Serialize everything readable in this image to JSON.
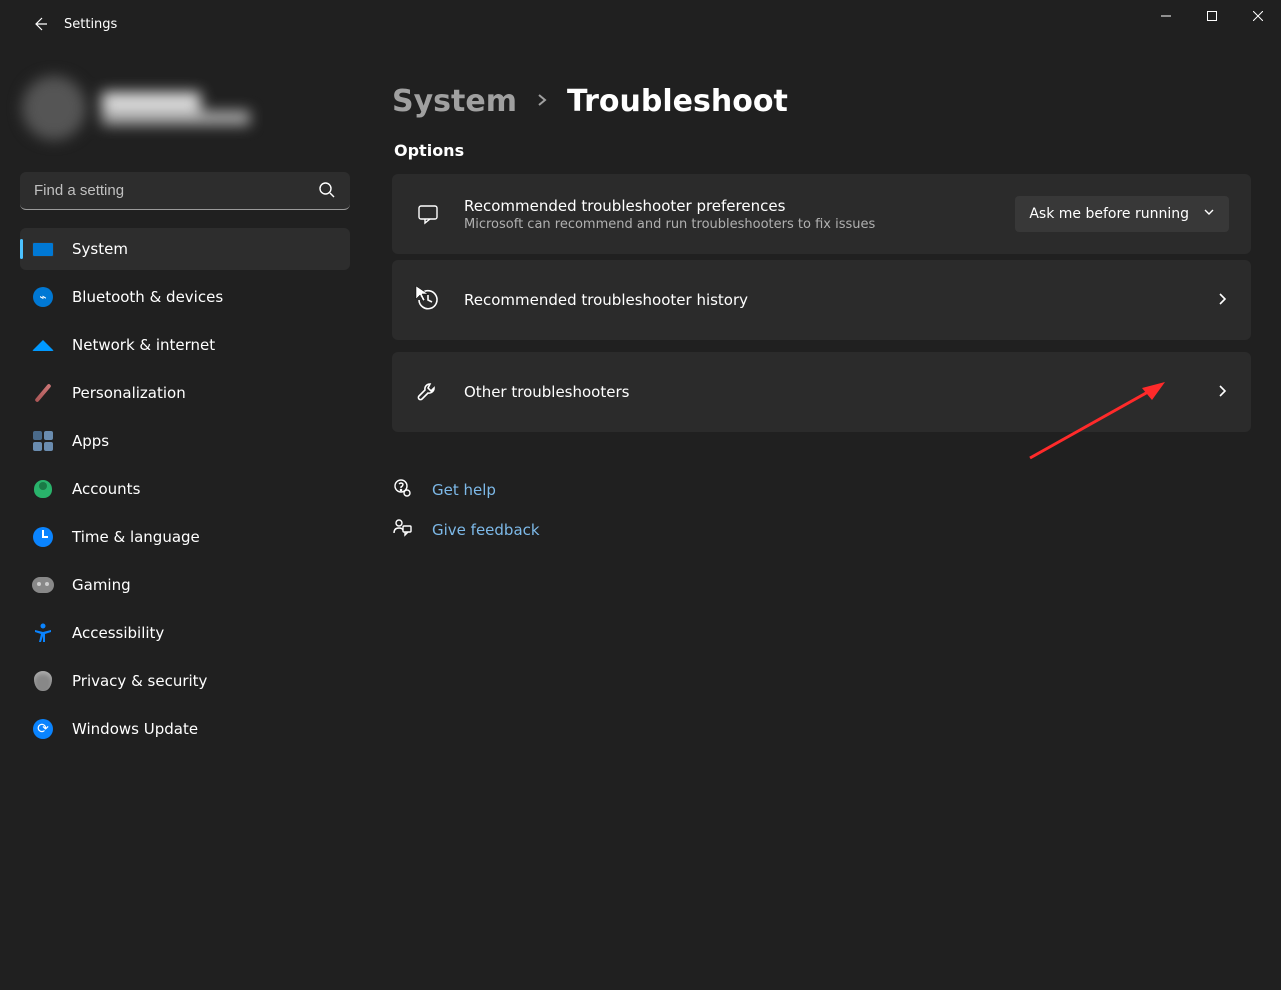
{
  "app_title": "Settings",
  "search": {
    "placeholder": "Find a setting"
  },
  "sidebar": {
    "items": [
      {
        "label": "System"
      },
      {
        "label": "Bluetooth & devices"
      },
      {
        "label": "Network & internet"
      },
      {
        "label": "Personalization"
      },
      {
        "label": "Apps"
      },
      {
        "label": "Accounts"
      },
      {
        "label": "Time & language"
      },
      {
        "label": "Gaming"
      },
      {
        "label": "Accessibility"
      },
      {
        "label": "Privacy & security"
      },
      {
        "label": "Windows Update"
      }
    ]
  },
  "breadcrumb": {
    "parent": "System",
    "current": "Troubleshoot"
  },
  "section_title": "Options",
  "cards": {
    "pref": {
      "title": "Recommended troubleshooter preferences",
      "sub": "Microsoft can recommend and run troubleshooters to fix issues",
      "dropdown": "Ask me before running"
    },
    "history": {
      "title": "Recommended troubleshooter history"
    },
    "other": {
      "title": "Other troubleshooters"
    }
  },
  "help": {
    "get_help": "Get help",
    "feedback": "Give feedback"
  }
}
